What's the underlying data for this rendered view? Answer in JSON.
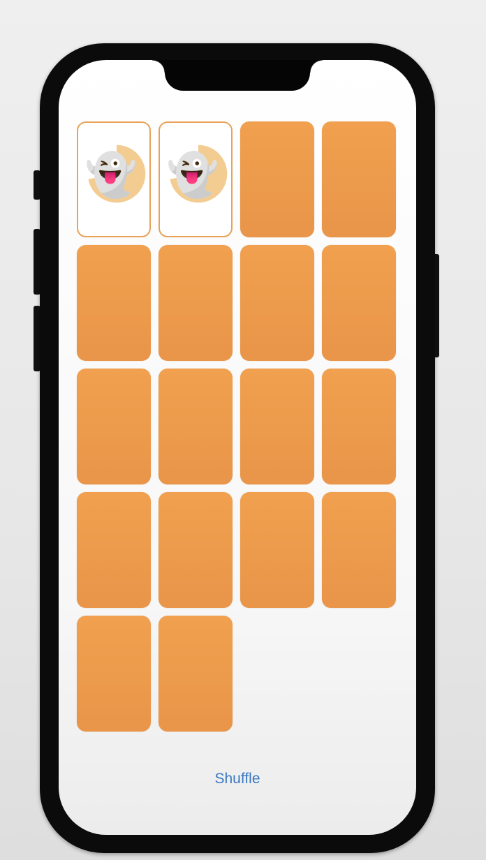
{
  "app": {
    "shuffle_label": "Shuffle",
    "accent_color": "#f0a04e",
    "link_color": "#3a78c2"
  },
  "cards": [
    {
      "face_up": true,
      "content": "👻",
      "pie_fraction": 0.72
    },
    {
      "face_up": true,
      "content": "👻",
      "pie_fraction": 0.72
    },
    {
      "face_up": false,
      "content": ""
    },
    {
      "face_up": false,
      "content": ""
    },
    {
      "face_up": false,
      "content": ""
    },
    {
      "face_up": false,
      "content": ""
    },
    {
      "face_up": false,
      "content": ""
    },
    {
      "face_up": false,
      "content": ""
    },
    {
      "face_up": false,
      "content": ""
    },
    {
      "face_up": false,
      "content": ""
    },
    {
      "face_up": false,
      "content": ""
    },
    {
      "face_up": false,
      "content": ""
    },
    {
      "face_up": false,
      "content": ""
    },
    {
      "face_up": false,
      "content": ""
    },
    {
      "face_up": false,
      "content": ""
    },
    {
      "face_up": false,
      "content": ""
    },
    {
      "face_up": false,
      "content": ""
    },
    {
      "face_up": false,
      "content": ""
    }
  ]
}
